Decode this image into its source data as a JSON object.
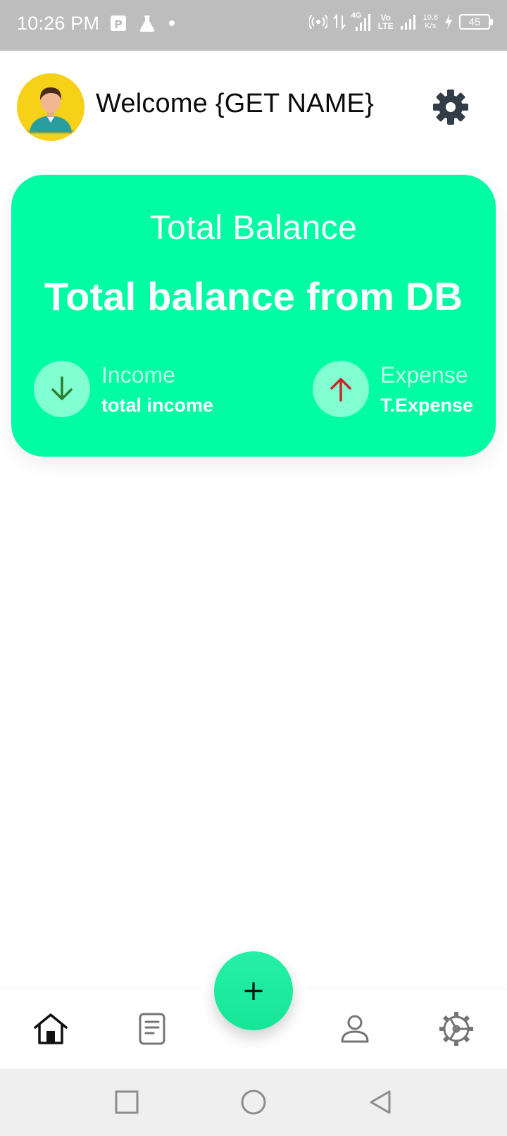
{
  "status_bar": {
    "time": "10:26 PM",
    "network_type": "4G",
    "volte": "Vo",
    "volte_sub": "LTE",
    "speed_value": "10.8",
    "speed_unit": "K/s",
    "battery": "45",
    "icons": [
      "parking-app-icon",
      "flask-icon",
      "dot-icon",
      "hotspot-icon",
      "data-arrows-icon",
      "signal-4g-icon",
      "volte-icon",
      "signal-icon",
      "charging-icon",
      "battery-icon"
    ]
  },
  "header": {
    "welcome_text": "Welcome {GET NAME}",
    "avatar_icon": "user-avatar",
    "settings_icon": "gear-icon"
  },
  "balance_card": {
    "title": "Total Balance",
    "value": "Total balance from DB",
    "income": {
      "label": "Income",
      "value": "total income",
      "icon": "arrow-down-icon",
      "icon_color": "#2e7d32"
    },
    "expense": {
      "label": "Expense",
      "value": "T.Expense",
      "icon": "arrow-up-icon",
      "icon_color": "#c62828"
    },
    "background_color": "#02fca4"
  },
  "fab": {
    "symbol": "+",
    "color": "#1ee99f"
  },
  "bottom_nav": {
    "items": [
      {
        "name": "home",
        "icon": "home-icon",
        "active": true
      },
      {
        "name": "records",
        "icon": "document-icon",
        "active": false
      },
      {
        "name": "profile",
        "icon": "person-icon",
        "active": false
      },
      {
        "name": "settings",
        "icon": "settings-wheel-icon",
        "active": false
      }
    ]
  },
  "system_nav": {
    "buttons": [
      "recent-apps-icon",
      "home-circle-icon",
      "back-triangle-icon"
    ]
  }
}
